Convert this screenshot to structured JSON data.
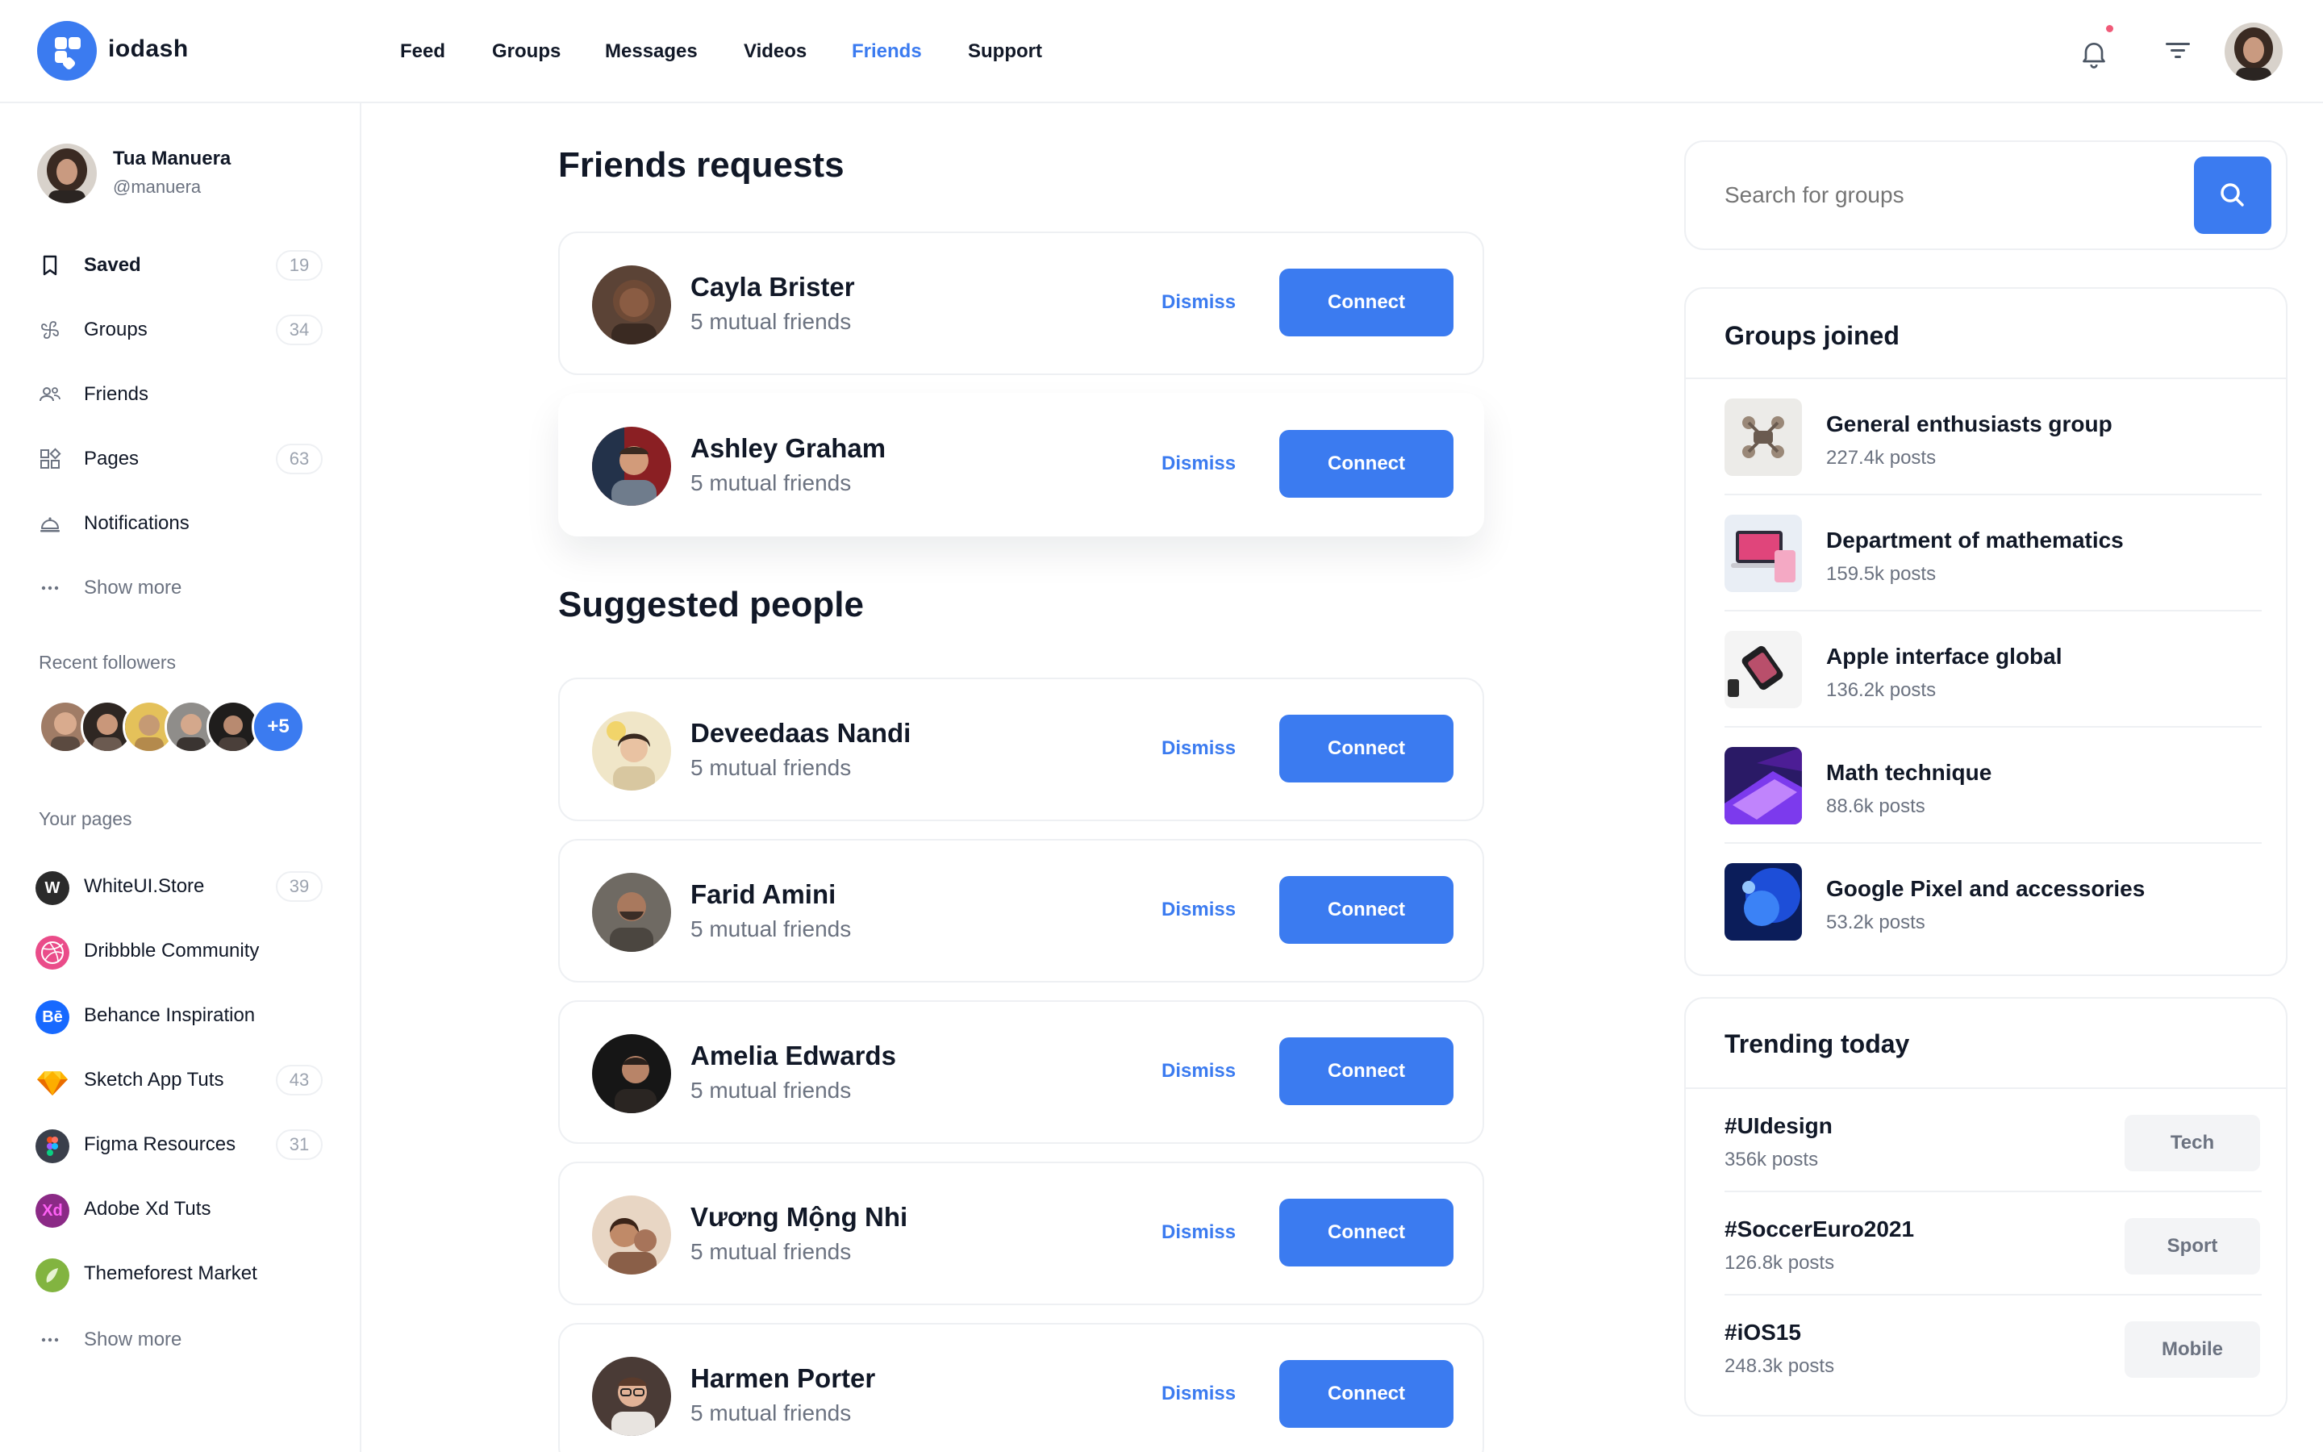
{
  "app": {
    "name": "iodash"
  },
  "colors": {
    "accent": "#3b7bf0",
    "notification_dot": "#f05a78",
    "text": "#111827",
    "muted": "#6b7280"
  },
  "nav": [
    {
      "label": "Feed",
      "active": false
    },
    {
      "label": "Groups",
      "active": false
    },
    {
      "label": "Messages",
      "active": false
    },
    {
      "label": "Videos",
      "active": false
    },
    {
      "label": "Friends",
      "active": true
    },
    {
      "label": "Support",
      "active": false
    }
  ],
  "header_icons": [
    "bell-icon",
    "filter-icon",
    "user-avatar"
  ],
  "profile": {
    "name": "Tua Manuera",
    "handle": "@manuera"
  },
  "sidebar": {
    "items": [
      {
        "label": "Saved",
        "count": "19",
        "icon": "bookmark-icon"
      },
      {
        "label": "Groups",
        "count": "34",
        "icon": "groups-icon"
      },
      {
        "label": "Friends",
        "count": "",
        "icon": "friends-icon"
      },
      {
        "label": "Pages",
        "count": "63",
        "icon": "pages-icon"
      },
      {
        "label": "Notifications",
        "count": "",
        "icon": "notifications-icon"
      },
      {
        "label": "Show more",
        "count": "",
        "icon": "more-icon"
      }
    ],
    "recent_followers_title": "Recent followers",
    "followers_more": "+5",
    "your_pages_title": "Your pages",
    "pages": [
      {
        "label": "WhiteUI.Store",
        "count": "39",
        "icon": "whiteui-icon"
      },
      {
        "label": "Dribbble Community",
        "count": "",
        "icon": "dribbble-icon"
      },
      {
        "label": "Behance Inspiration",
        "count": "",
        "icon": "behance-icon"
      },
      {
        "label": "Sketch App Tuts",
        "count": "43",
        "icon": "sketch-icon"
      },
      {
        "label": "Figma Resources",
        "count": "31",
        "icon": "figma-icon"
      },
      {
        "label": "Adobe Xd Tuts",
        "count": "",
        "icon": "adobe-xd-icon"
      },
      {
        "label": "Themeforest Market",
        "count": "",
        "icon": "themeforest-icon"
      }
    ],
    "show_more_pages": "Show more"
  },
  "friend_requests": {
    "title": "Friends requests",
    "items": [
      {
        "name": "Cayla Brister",
        "mutual": "5 mutual friends"
      },
      {
        "name": "Ashley Graham",
        "mutual": "5 mutual friends"
      }
    ]
  },
  "suggested": {
    "title": "Suggested people",
    "items": [
      {
        "name": "Deveedaas Nandi",
        "mutual": "5 mutual friends"
      },
      {
        "name": "Farid Amini",
        "mutual": "5 mutual friends"
      },
      {
        "name": "Amelia Edwards",
        "mutual": "5 mutual friends"
      },
      {
        "name": "Vương Mộng Nhi",
        "mutual": "5 mutual friends"
      },
      {
        "name": "Harmen Porter",
        "mutual": "5 mutual friends"
      }
    ]
  },
  "actions": {
    "dismiss": "Dismiss",
    "connect": "Connect"
  },
  "search": {
    "placeholder": "Search for groups"
  },
  "groups_joined": {
    "title": "Groups joined",
    "items": [
      {
        "name": "General enthusiasts group",
        "posts": "227.4k posts"
      },
      {
        "name": "Department of mathematics",
        "posts": "159.5k posts"
      },
      {
        "name": "Apple interface global",
        "posts": "136.2k posts"
      },
      {
        "name": "Math technique",
        "posts": "88.6k posts"
      },
      {
        "name": "Google Pixel and accessories",
        "posts": "53.2k posts"
      }
    ]
  },
  "trending": {
    "title": "Trending today",
    "items": [
      {
        "tag": "#UIdesign",
        "posts": "356k posts",
        "category": "Tech"
      },
      {
        "tag": "#SoccerEuro2021",
        "posts": "126.8k posts",
        "category": "Sport"
      },
      {
        "tag": "#iOS15",
        "posts": "248.3k posts",
        "category": "Mobile"
      }
    ]
  }
}
